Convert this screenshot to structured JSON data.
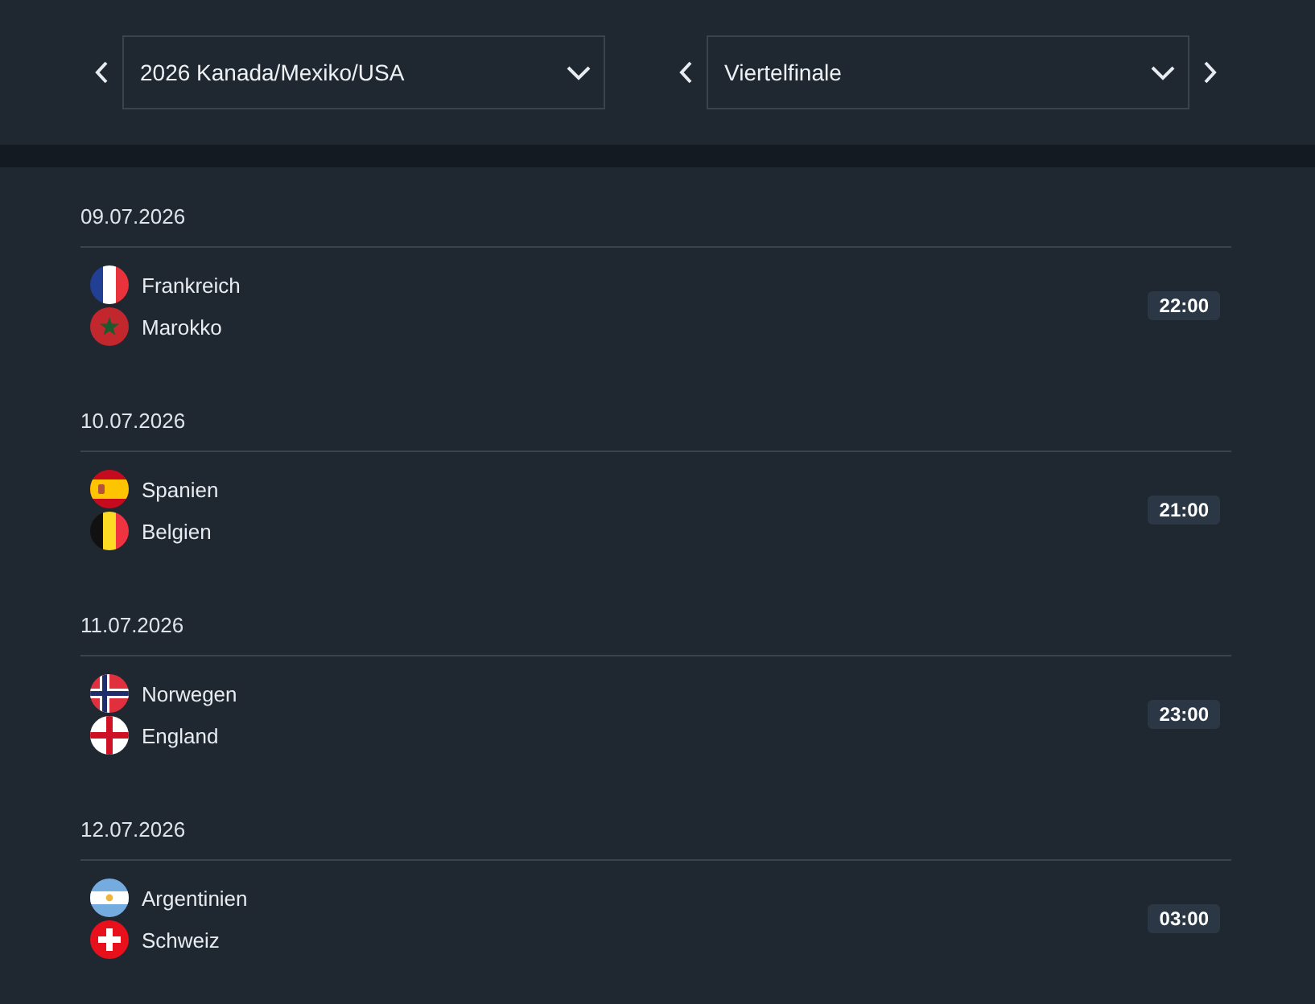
{
  "filters": [
    {
      "value": "2026 Kanada/Mexiko/USA",
      "previous_button": true,
      "next_button": false
    },
    {
      "value": "Viertelfinale",
      "previous_button": true,
      "next_button": true
    }
  ],
  "days": [
    {
      "date": "09.07.2026",
      "matches": [
        {
          "teams": [
            "Frankreich",
            "Marokko"
          ],
          "time": "22:00"
        }
      ]
    },
    {
      "date": "10.07.2026",
      "matches": [
        {
          "teams": [
            "Spanien",
            "Belgien"
          ],
          "time": "21:00"
        }
      ]
    },
    {
      "date": "11.07.2026",
      "matches": [
        {
          "teams": [
            "Norwegen",
            "England"
          ],
          "time": "23:00"
        }
      ]
    },
    {
      "date": "12.07.2026",
      "matches": [
        {
          "teams": [
            "Argentinien",
            "Schweiz"
          ],
          "time": "03:00"
        }
      ]
    }
  ]
}
